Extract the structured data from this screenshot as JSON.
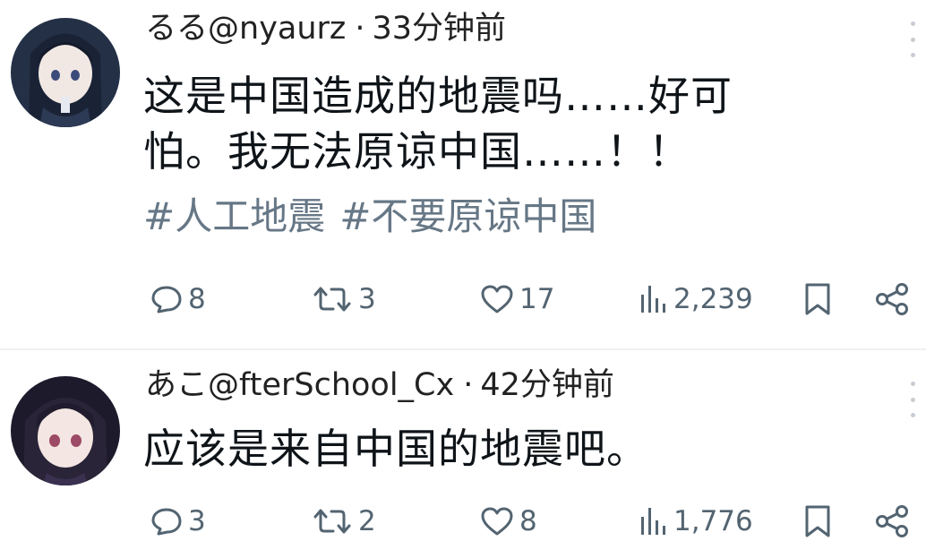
{
  "posts": [
    {
      "name": "るる",
      "handle": "@nyaurz",
      "separator": "·",
      "time": "33分钟前",
      "text_lines": [
        "这是中国造成的地震吗……好可",
        "怕。我无法原谅中国……！！"
      ],
      "hashtags": [
        "#人工地震",
        "#不要原谅中国"
      ],
      "stats": {
        "replies": "8",
        "reposts": "3",
        "likes": "17",
        "views": "2,239"
      }
    },
    {
      "name": "あこ",
      "handle": "@fterSchool_Cx",
      "separator": "·",
      "time": "42分钟前",
      "text_lines": [
        "应该是来自中国的地震吧。"
      ],
      "stats": {
        "replies": "3",
        "reposts": "2",
        "likes": "8",
        "views": "1,776"
      }
    }
  ],
  "colors": {
    "text": "#0f1419",
    "secondary": "#536471",
    "hashtag": "#667786",
    "divider": "#eef1f3"
  },
  "icons": [
    "reply-icon",
    "repost-icon",
    "like-icon",
    "views-icon",
    "bookmark-icon",
    "share-icon",
    "more-icon"
  ]
}
